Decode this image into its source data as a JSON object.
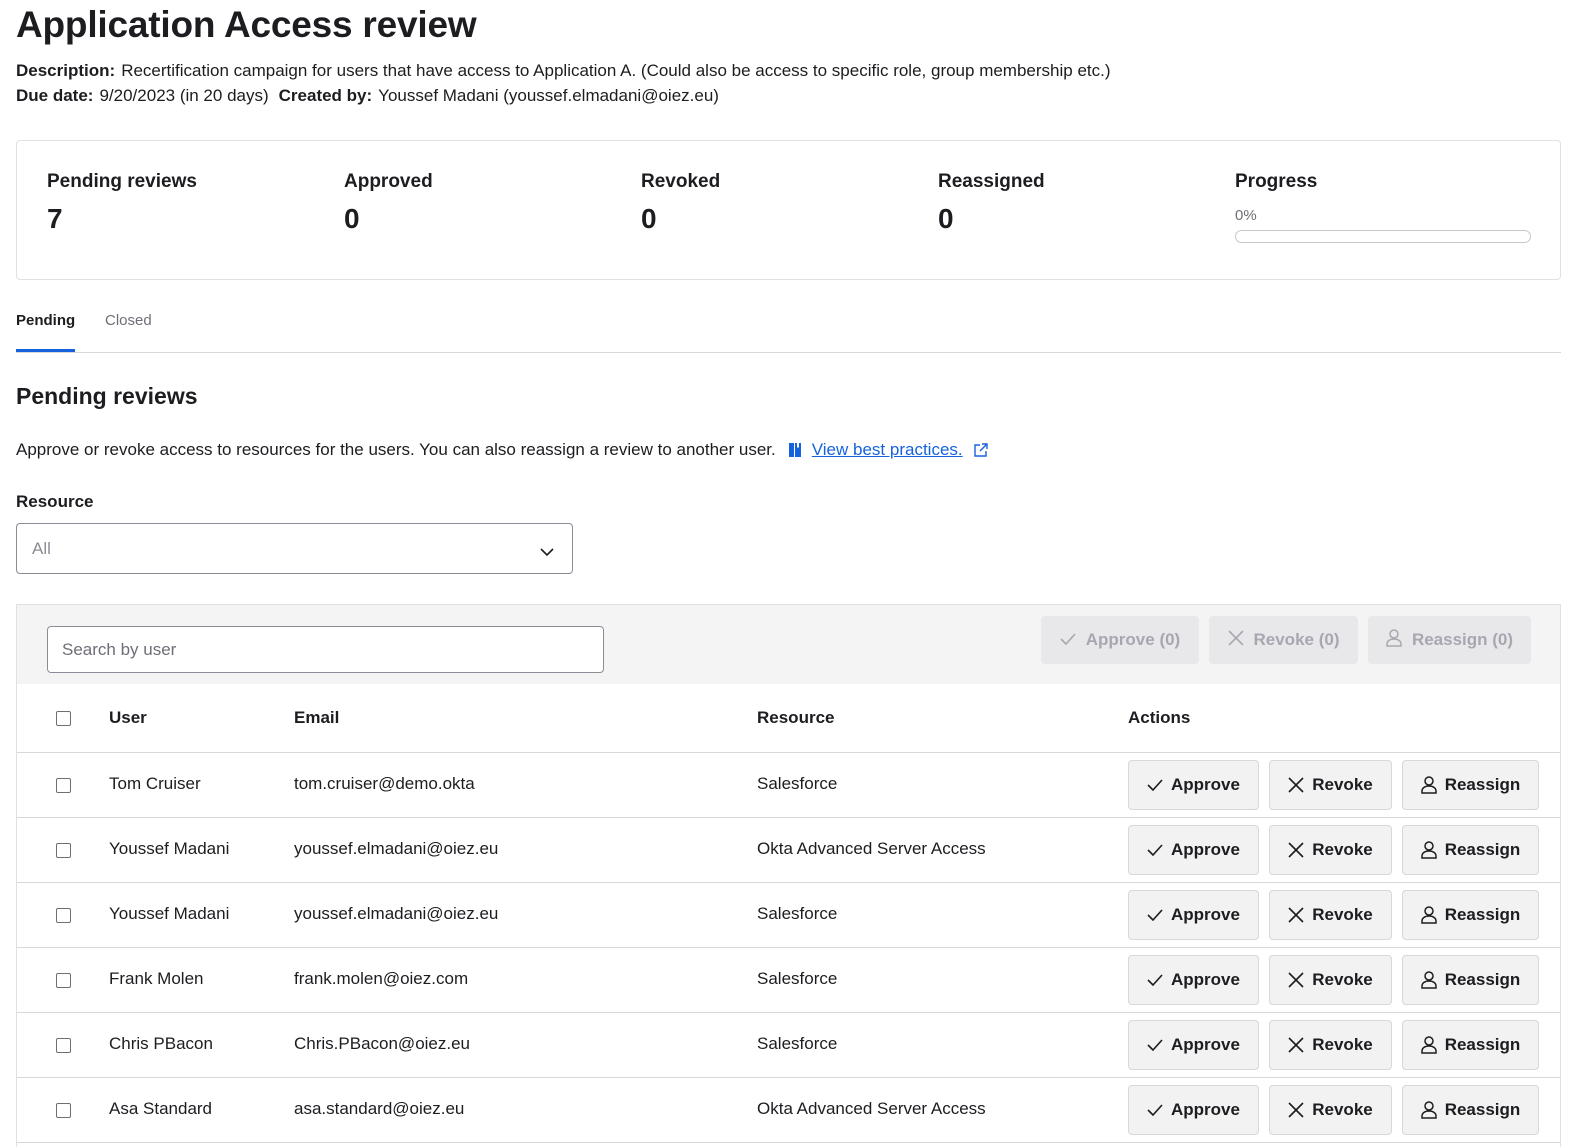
{
  "header": {
    "title": "Application Access review",
    "description_label": "Description:",
    "description": "Recertification campaign for users that have access to Application A. (Could also be access to specific role, group membership etc.)",
    "due_date_label": "Due date:",
    "due_date": "9/20/2023 (in 20 days)",
    "created_by_label": "Created by:",
    "created_by": "Youssef Madani (youssef.elmadani@oiez.eu)"
  },
  "stats": {
    "pending_label": "Pending reviews",
    "pending_value": "7",
    "approved_label": "Approved",
    "approved_value": "0",
    "revoked_label": "Revoked",
    "revoked_value": "0",
    "reassigned_label": "Reassigned",
    "reassigned_value": "0",
    "progress_label": "Progress",
    "progress_text": "0%",
    "progress_fraction": 0
  },
  "tabs": [
    {
      "label": "Pending",
      "active": true
    },
    {
      "label": "Closed",
      "active": false
    }
  ],
  "section": {
    "title": "Pending reviews",
    "description": "Approve or revoke access to resources for the users. You can also reassign a review to another user.",
    "link_text": "View best practices."
  },
  "filter": {
    "label": "Resource",
    "selected": "All"
  },
  "toolbar": {
    "search_placeholder": "Search by user",
    "approve_label": "Approve (0)",
    "revoke_label": "Revoke (0)",
    "reassign_label": "Reassign (0)"
  },
  "table": {
    "columns": [
      "User",
      "Email",
      "Resource",
      "Actions"
    ],
    "rows": [
      {
        "user": "Tom Cruiser",
        "email": "tom.cruiser@demo.okta",
        "resource": "Salesforce"
      },
      {
        "user": "Youssef Madani",
        "email": "youssef.elmadani@oiez.eu",
        "resource": "Okta Advanced Server Access"
      },
      {
        "user": "Youssef Madani",
        "email": "youssef.elmadani@oiez.eu",
        "resource": "Salesforce"
      },
      {
        "user": "Frank Molen",
        "email": "frank.molen@oiez.com",
        "resource": "Salesforce"
      },
      {
        "user": "Chris PBacon",
        "email": "Chris.PBacon@oiez.eu",
        "resource": "Salesforce"
      },
      {
        "user": "Asa Standard",
        "email": "asa.standard@oiez.eu",
        "resource": "Okta Advanced Server Access"
      }
    ],
    "action_labels": {
      "approve": "Approve",
      "revoke": "Revoke",
      "reassign": "Reassign"
    }
  },
  "colors": {
    "accent": "#1662dd",
    "text": "#1d1d21",
    "muted": "#6e6e78",
    "border": "#d7d7dc",
    "toolbar_bg": "#f4f4f5"
  },
  "icons": [
    "document-icon",
    "external-link-icon",
    "chevron-down-icon",
    "check-icon",
    "close-icon",
    "person-icon"
  ]
}
